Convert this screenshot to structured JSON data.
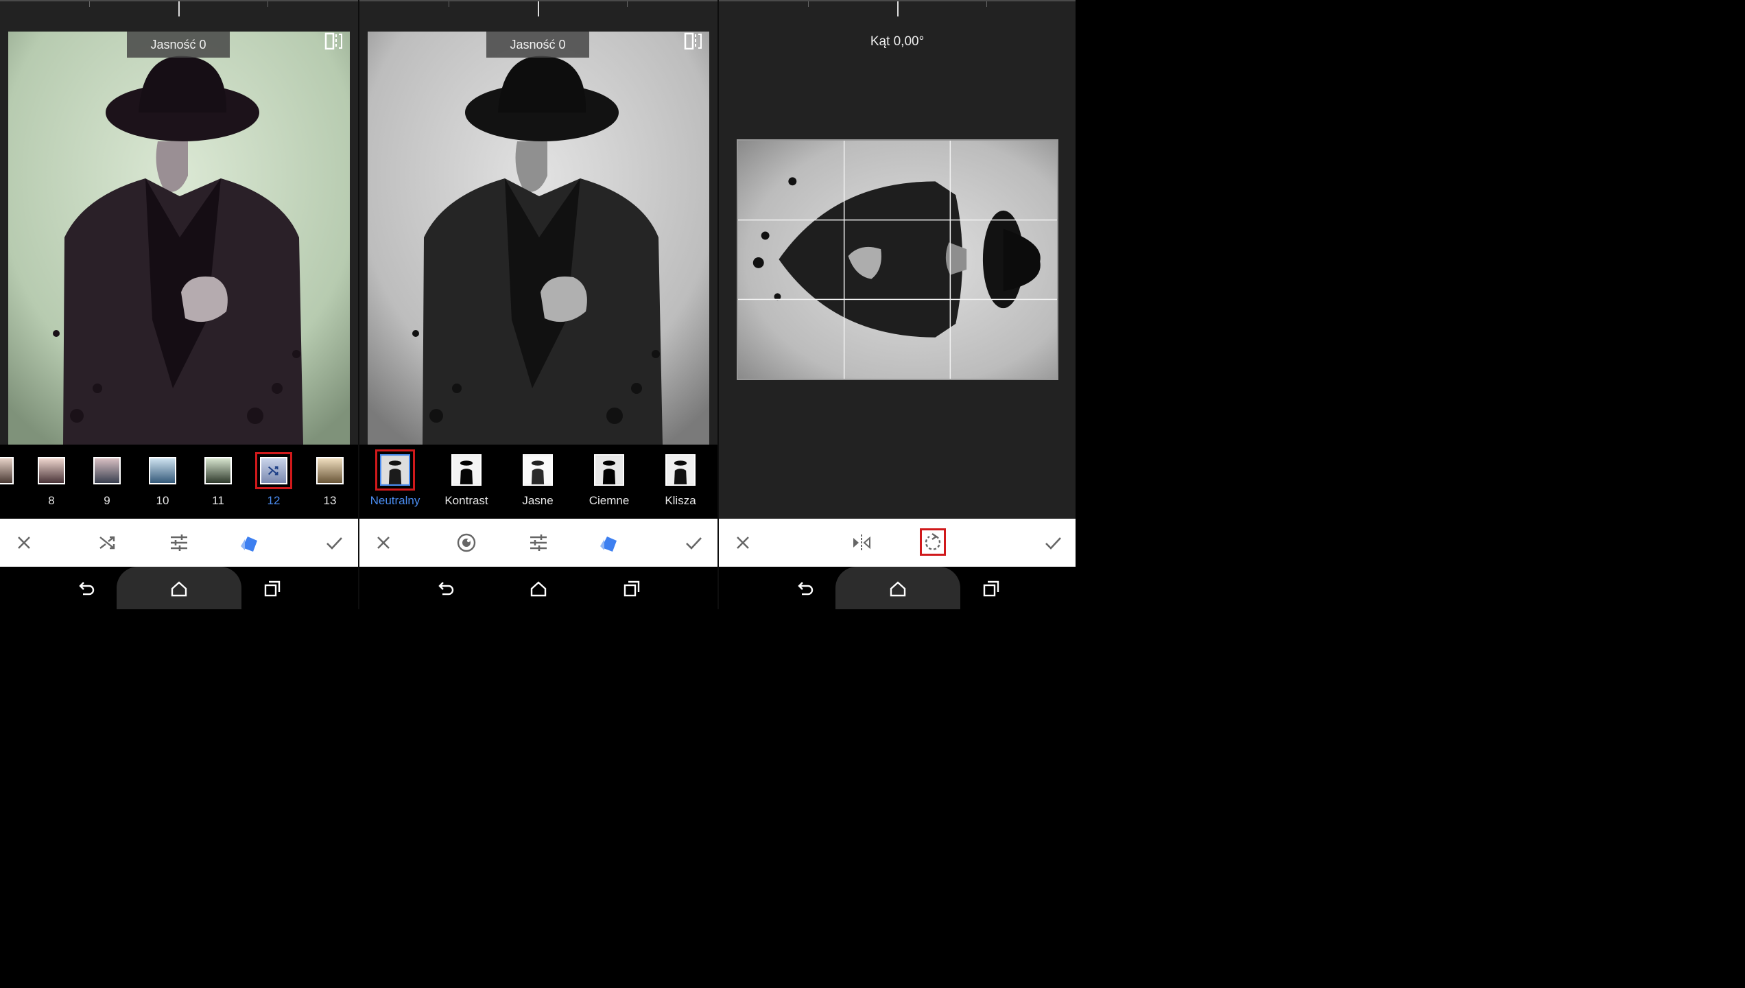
{
  "panel1": {
    "brightness_label": "Jasność 0",
    "filters": [
      {
        "label": "",
        "color_top": "#e7d3c8",
        "color_bottom": "#4a3a34"
      },
      {
        "label": "8",
        "color_top": "#f0d8d0",
        "color_bottom": "#4a3438"
      },
      {
        "label": "9",
        "color_top": "#d9c0c3",
        "color_bottom": "#3a4050"
      },
      {
        "label": "10",
        "color_top": "#cfe3f0",
        "color_bottom": "#355a7a"
      },
      {
        "label": "11",
        "color_top": "#d8e6d0",
        "color_bottom": "#2f3a2c"
      },
      {
        "label": "12",
        "color_top": "#c9d4ea",
        "color_bottom": "#7c8ab0"
      },
      {
        "label": "13",
        "color_top": "#f0dfc0",
        "color_bottom": "#6a5638"
      }
    ],
    "selected_filter": "12",
    "photo_tint": "#c9dcc4"
  },
  "panel2": {
    "brightness_label": "Jasność 0",
    "styles": [
      "Neutralny",
      "Kontrast",
      "Jasne",
      "Ciemne",
      "Klisza"
    ],
    "selected_style": "Neutralny"
  },
  "panel3": {
    "angle_label": "Kąt 0,00°"
  },
  "toolbar": {
    "panel1_icons": [
      "close-icon",
      "shuffle-icon",
      "sliders-icon",
      "styles-icon",
      "check-icon"
    ],
    "panel2_icons": [
      "close-icon",
      "brush-icon",
      "sliders-icon",
      "styles-icon",
      "check-icon"
    ],
    "panel3_icons": [
      "close-icon",
      "flip-icon",
      "rotate-icon",
      "check-icon"
    ]
  },
  "navbar": {
    "icons": [
      "back-icon",
      "home-icon",
      "recents-icon"
    ]
  },
  "colors": {
    "accent_blue": "#4a8cf0",
    "selection_red": "#d0191b",
    "toolbar_bg": "#ffffff",
    "editor_bg": "#222222"
  }
}
